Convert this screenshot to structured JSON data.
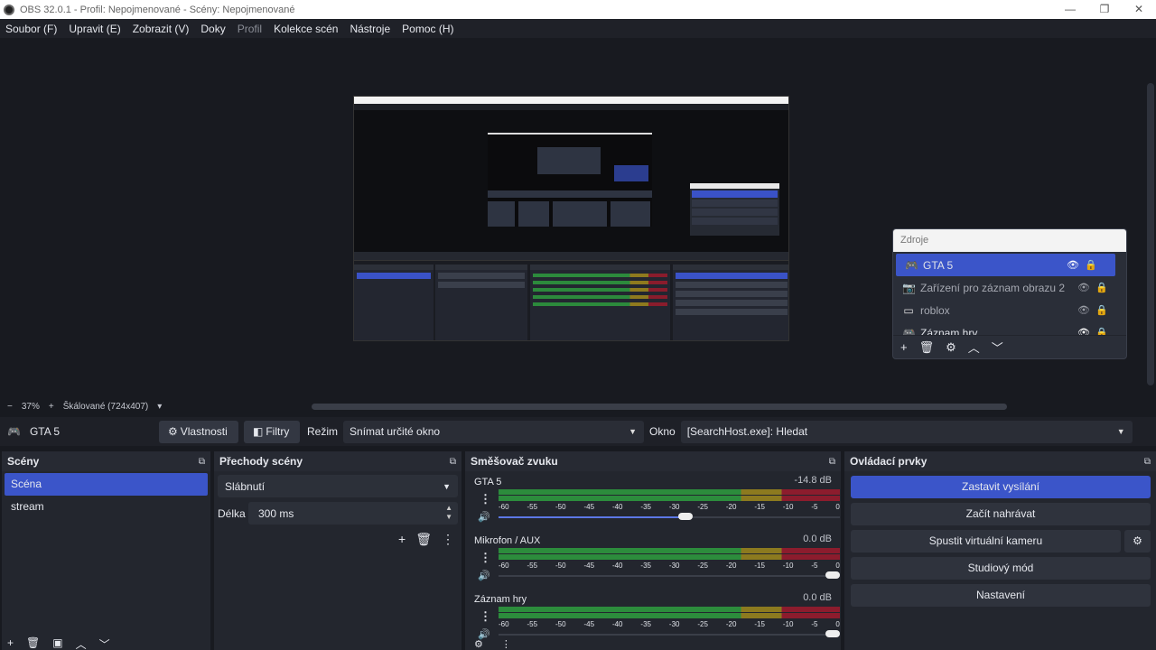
{
  "window": {
    "title": "OBS 32.0.1 - Profil: Nepojmenované - Scény: Nepojmenované",
    "min": "—",
    "max": "❐",
    "close": "✕"
  },
  "menu": [
    "Soubor (F)",
    "Upravit (E)",
    "Zobrazit (V)",
    "Doky",
    "Profil",
    "Kolekce scén",
    "Nástroje",
    "Pomoc (H)"
  ],
  "sources_dock": {
    "title": "Zdroje",
    "items": [
      {
        "label": "GTA 5",
        "icon": "gamepad-icon"
      },
      {
        "label": "Zařízení pro záznam obrazu 2",
        "icon": "camera-icon"
      },
      {
        "label": "roblox",
        "icon": "window-icon"
      },
      {
        "label": "Záznam hry",
        "icon": "gamepad-icon"
      }
    ],
    "tools": [
      "+",
      "🗑",
      "⚙",
      "︿",
      "﹀"
    ]
  },
  "zoom": {
    "minus": "−",
    "value": "37%",
    "plus": "+",
    "mode": "Škálované (724x407)",
    "arrow": "▾"
  },
  "source_toolbar": {
    "source_name": "GTA 5",
    "properties_label": "Vlastnosti",
    "filters_label": "Filtry",
    "mode_label": "Režim",
    "mode_value": "Snímat určité okno",
    "window_label": "Okno",
    "window_value": "[SearchHost.exe]: Hledat"
  },
  "scenes": {
    "title": "Scény",
    "items": [
      "Scéna",
      "stream"
    ],
    "tools": [
      "+",
      "🗑",
      "▣",
      "︿",
      "﹀"
    ]
  },
  "transitions": {
    "title": "Přechody scény",
    "selected": "Slábnutí",
    "duration_label": "Délka",
    "duration_value": "300 ms",
    "tools": [
      "+",
      "🗑",
      "⋮"
    ]
  },
  "mixer": {
    "title": "Směšovač zvuku",
    "scale": [
      "-60",
      "-55",
      "-50",
      "-45",
      "-40",
      "-35",
      "-30",
      "-25",
      "-20",
      "-15",
      "-10",
      "-5",
      "0"
    ],
    "channels": [
      {
        "name": "GTA 5",
        "db": "-14.8 dB",
        "volume": 0.55
      },
      {
        "name": "Mikrofon / AUX",
        "db": "0.0 dB",
        "volume": 1.0
      },
      {
        "name": "Záznam hry",
        "db": "0.0 dB",
        "volume": 1.0
      }
    ],
    "tools": [
      "⚙",
      "⋮"
    ]
  },
  "controls": {
    "title": "Ovládací prvky",
    "stop_stream": "Zastavit vysílání",
    "start_record": "Začít nahrávat",
    "virtual_cam": "Spustit virtuální kameru",
    "studio_mode": "Studiový mód",
    "settings": "Nastavení"
  },
  "icons": {
    "popout": "⧉",
    "eye": "👁",
    "lock": "🔒",
    "menu_dots": "⋮",
    "speaker": "🔊",
    "gear": "⚙"
  },
  "colors": {
    "accent": "#3b55c9",
    "meter_green": "#2c8c3c",
    "meter_yellow": "#8c7a1f",
    "meter_red": "#8c1c2d"
  }
}
